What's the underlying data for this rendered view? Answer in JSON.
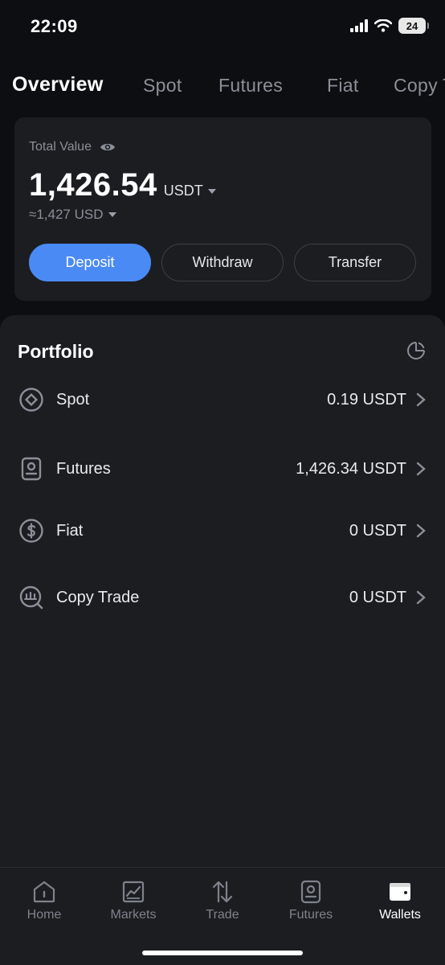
{
  "status": {
    "time": "22:09",
    "battery": "24"
  },
  "tabs": [
    {
      "label": "Overview",
      "active": true
    },
    {
      "label": "Spot"
    },
    {
      "label": "Futures"
    },
    {
      "label": "Fiat"
    },
    {
      "label": "Copy T"
    }
  ],
  "summary": {
    "label": "Total Value",
    "amount": "1,426.54",
    "unit": "USDT",
    "approx": "≈1,427 USD"
  },
  "actions": {
    "deposit": "Deposit",
    "withdraw": "Withdraw",
    "transfer": "Transfer"
  },
  "portfolio": {
    "title": "Portfolio",
    "items": [
      {
        "name": "Spot",
        "value": "0.19 USDT",
        "icon": "spot-icon"
      },
      {
        "name": "Futures",
        "value": "1,426.34 USDT",
        "icon": "futures-icon"
      },
      {
        "name": "Fiat",
        "value": "0 USDT",
        "icon": "dollar-icon"
      },
      {
        "name": "Copy Trade",
        "value": "0 USDT",
        "icon": "copy-trade-icon"
      }
    ]
  },
  "nav": [
    {
      "label": "Home",
      "icon": "home-icon"
    },
    {
      "label": "Markets",
      "icon": "chart-icon"
    },
    {
      "label": "Trade",
      "icon": "trade-arrows-icon"
    },
    {
      "label": "Futures",
      "icon": "futures-icon"
    },
    {
      "label": "Wallets",
      "icon": "wallet-icon",
      "active": true
    }
  ],
  "colors": {
    "accent": "#4a8af4",
    "background": "#0d0e11",
    "card": "#1c1d21"
  }
}
